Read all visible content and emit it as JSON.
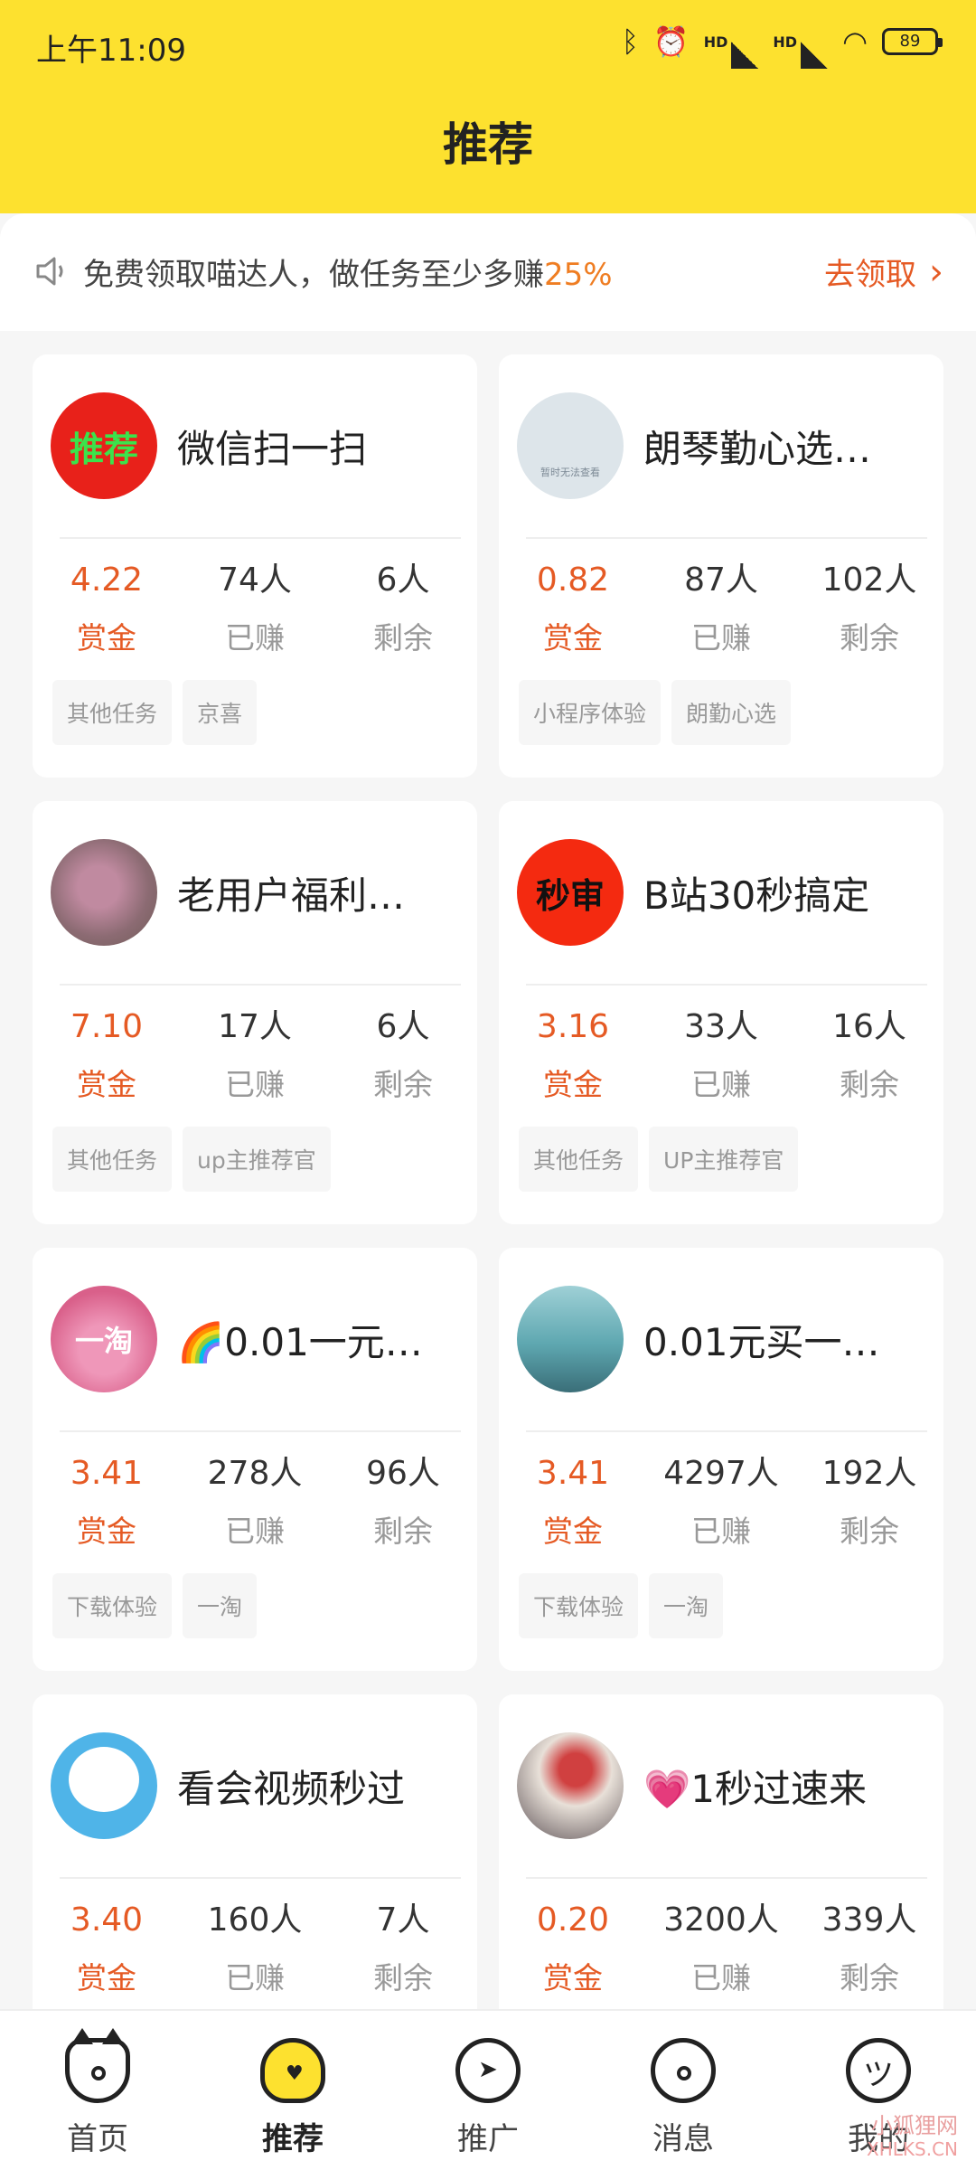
{
  "status_bar": {
    "time": "上午11:09",
    "icons": [
      "bluetooth-icon",
      "alarm-icon",
      "signal-icon",
      "signal-icon",
      "wifi-icon"
    ],
    "net_label": "HD",
    "battery": "89"
  },
  "header": {
    "title": "推荐",
    "background": "#fde12f"
  },
  "notice": {
    "text": "免费领取喵达人，做任务至少多赚",
    "highlight": "25%",
    "link": "去领取"
  },
  "cards": [
    {
      "title": "微信扫一扫",
      "avatar_text": "推荐",
      "reward": "4.22",
      "earned": "74人",
      "remaining": "6人",
      "tags": [
        "其他任务",
        "京喜"
      ]
    },
    {
      "title": "朗琴勤心选…",
      "avatar_text": "",
      "reward": "0.82",
      "earned": "87人",
      "remaining": "102人",
      "tags": [
        "小程序体验",
        "朗勤心选"
      ]
    },
    {
      "title": "老用户福利…",
      "avatar_text": "",
      "reward": "7.10",
      "earned": "17人",
      "remaining": "6人",
      "tags": [
        "其他任务",
        "up主推荐官"
      ]
    },
    {
      "title": "B站30秒搞定",
      "avatar_text": "秒审",
      "reward": "3.16",
      "earned": "33人",
      "remaining": "16人",
      "tags": [
        "其他任务",
        "UP主推荐官"
      ]
    },
    {
      "title": "🌈0.01一元…",
      "avatar_text": "一淘",
      "reward": "3.41",
      "earned": "278人",
      "remaining": "96人",
      "tags": [
        "下载体验",
        "一淘"
      ]
    },
    {
      "title": "0.01元买一…",
      "avatar_text": "",
      "reward": "3.41",
      "earned": "4297人",
      "remaining": "192人",
      "tags": [
        "下载体验",
        "一淘"
      ]
    },
    {
      "title": "看会视频秒过",
      "avatar_text": "",
      "reward": "3.40",
      "earned": "160人",
      "remaining": "7人",
      "tags": []
    },
    {
      "title": "💗1秒过速来",
      "avatar_text": "",
      "reward": "0.20",
      "earned": "3200人",
      "remaining": "339人",
      "tags": []
    }
  ],
  "stat_labels": {
    "reward": "赏金",
    "earned": "已赚",
    "remaining": "剩余"
  },
  "tabbar": [
    {
      "label": "首页",
      "icon": "home-cat-icon"
    },
    {
      "label": "推荐",
      "icon": "recommend-heart-icon",
      "active": true
    },
    {
      "label": "推广",
      "icon": "promote-arrow-icon"
    },
    {
      "label": "消息",
      "icon": "message-icon"
    },
    {
      "label": "我的",
      "icon": "profile-face-icon"
    }
  ],
  "watermark": {
    "line1": "小狐狸网",
    "line2": "XHLKS.CN"
  },
  "colors": {
    "accent": "#e55a24",
    "highlight": "#ef7d22"
  }
}
